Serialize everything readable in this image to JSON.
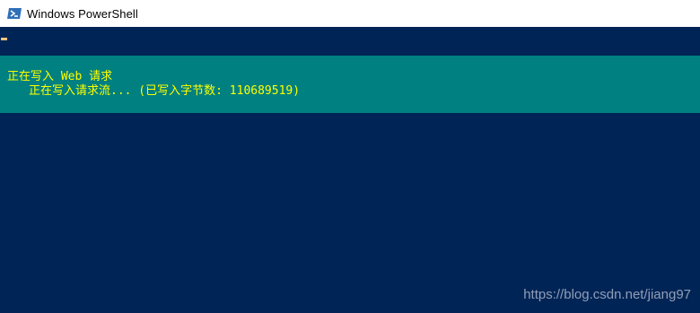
{
  "window": {
    "title": "Windows PowerShell",
    "icon": "powershell-icon"
  },
  "console": {
    "background": "#012456",
    "progress": {
      "background": "#008080",
      "text_color": "#FFFF00",
      "activity": "正在写入 Web 请求",
      "status": "正在写入请求流... (已写入字节数: 110689519)"
    }
  },
  "watermark": "https://blog.csdn.net/jiang97"
}
